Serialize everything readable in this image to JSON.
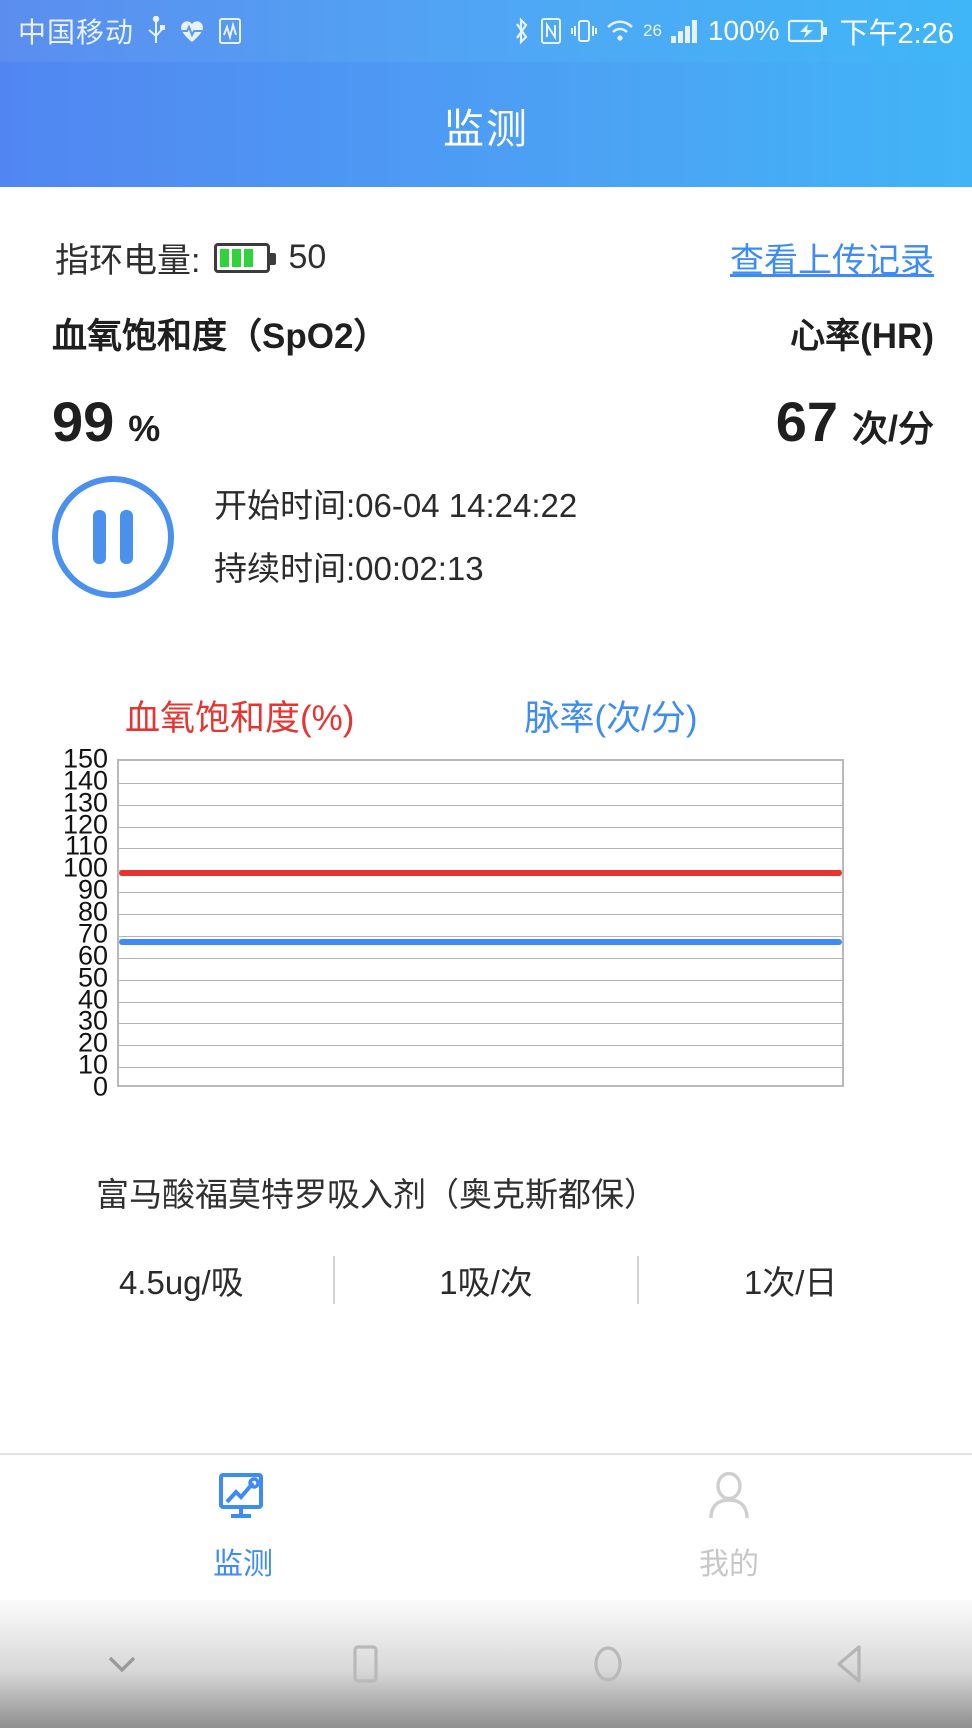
{
  "status_bar": {
    "carrier": "中国移动",
    "icons": [
      "usb-icon",
      "heart-pulse-icon",
      "app-badge-icon",
      "bluetooth-icon",
      "nfc-icon",
      "vibrate-icon",
      "wifi-icon",
      "signal-icon",
      "battery-icon"
    ],
    "network_gen": "26",
    "battery_percent": "100%",
    "time": "下午2:26"
  },
  "app_bar": {
    "title": "监测"
  },
  "battery_row": {
    "label": "指环电量:",
    "value": "50",
    "upload_link": "查看上传记录",
    "link_color": "#3d8cf5",
    "fill_color": "#2fd43a"
  },
  "vitals": {
    "spo2": {
      "label": "血氧饱和度（SpO2）",
      "value": "99",
      "unit": "%"
    },
    "hr": {
      "label": "心率(HR)",
      "value": "67",
      "unit": "次/分"
    }
  },
  "session": {
    "pause_button": "pause-button",
    "start_time": "开始时间:06-04 14:24:22",
    "duration": "持续时间:00:02:13"
  },
  "chart_data": {
    "type": "line",
    "title": "",
    "xlabel": "",
    "ylabel": "",
    "ylim": [
      0,
      150
    ],
    "yticks": [
      150,
      140,
      130,
      120,
      110,
      100,
      90,
      80,
      70,
      60,
      50,
      40,
      30,
      20,
      10,
      0
    ],
    "grid": true,
    "legend_position": "top",
    "series": [
      {
        "name": "血氧饱和度(%)",
        "color": "#e8332f",
        "constant_value": 99,
        "values": [
          99,
          99,
          99,
          99,
          99,
          99,
          99,
          99,
          99,
          99,
          99,
          99,
          99,
          99,
          99,
          99,
          99,
          99,
          99,
          99
        ]
      },
      {
        "name": "脉率(次/分)",
        "color": "#3d8cf5",
        "constant_value": 67,
        "values": [
          67,
          67,
          67,
          67,
          67,
          67,
          67,
          67,
          67,
          67,
          67,
          67,
          67,
          67,
          67,
          67,
          67,
          67,
          67,
          67
        ]
      }
    ]
  },
  "medication": {
    "name": "富马酸福莫特罗吸入剂（奥克斯都保）",
    "columns": [
      "4.5ug/吸",
      "1吸/次",
      "1次/日"
    ]
  },
  "tab_bar": {
    "tabs": [
      {
        "label": "监测",
        "icon": "monitor-chart-icon",
        "active": true
      },
      {
        "label": "我的",
        "icon": "person-icon",
        "active": false
      }
    ]
  },
  "nav_bar": {
    "buttons": [
      "hide-keyboard-icon",
      "recents-icon",
      "home-icon",
      "back-icon"
    ]
  }
}
